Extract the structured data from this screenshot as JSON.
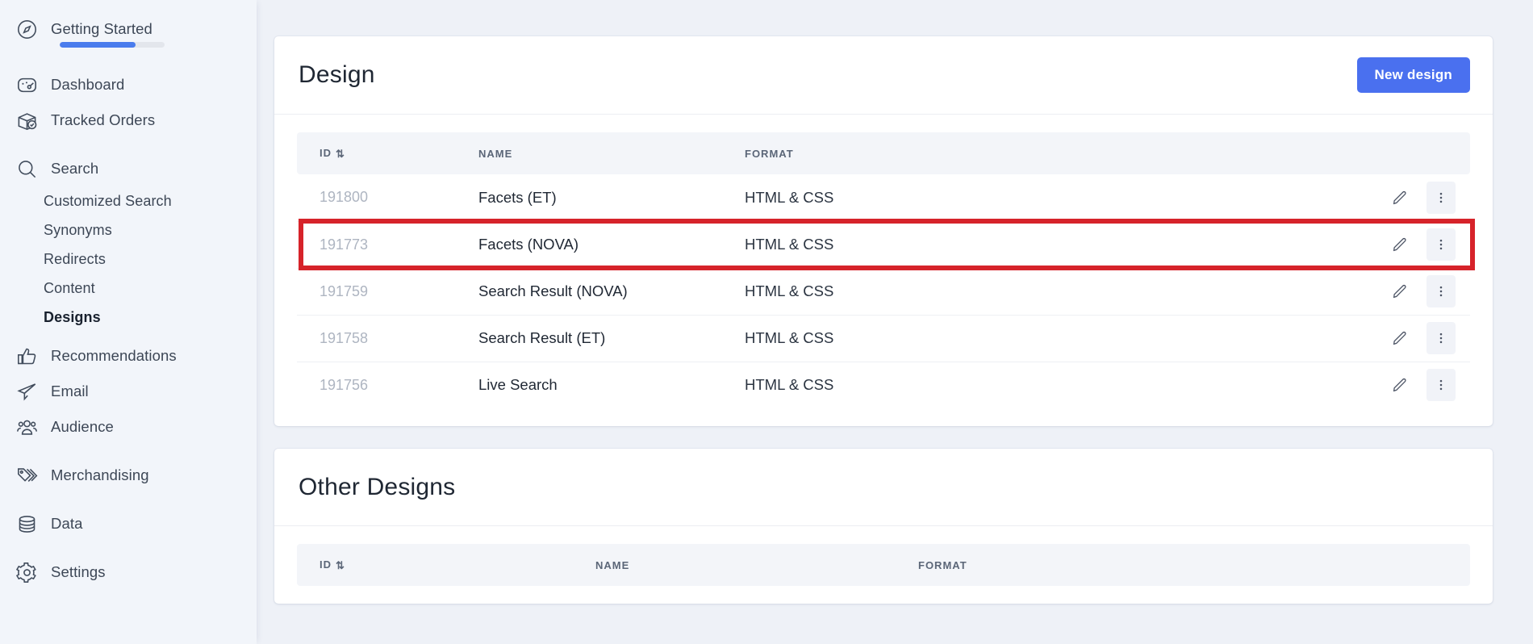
{
  "sidebar": {
    "getting_started": {
      "label": "Getting Started",
      "icon": "compass-icon",
      "progress_percent": 72
    },
    "items": [
      {
        "label": "Dashboard",
        "icon": "gauge-icon",
        "type": "top"
      },
      {
        "label": "Tracked Orders",
        "icon": "package-check-icon",
        "type": "top"
      },
      {
        "label": "Search",
        "icon": "search-icon",
        "type": "top"
      },
      {
        "label": "Customized Search",
        "icon": "",
        "type": "sub"
      },
      {
        "label": "Synonyms",
        "icon": "",
        "type": "sub"
      },
      {
        "label": "Redirects",
        "icon": "",
        "type": "sub"
      },
      {
        "label": "Content",
        "icon": "",
        "type": "sub"
      },
      {
        "label": "Designs",
        "icon": "",
        "type": "sub",
        "active": true
      },
      {
        "label": "Recommendations",
        "icon": "thumbs-up-icon",
        "type": "top"
      },
      {
        "label": "Email",
        "icon": "paper-plane-icon",
        "type": "top"
      },
      {
        "label": "Audience",
        "icon": "people-icon",
        "type": "top"
      },
      {
        "label": "Merchandising",
        "icon": "tags-icon",
        "type": "top"
      },
      {
        "label": "Data",
        "icon": "database-icon",
        "type": "top"
      },
      {
        "label": "Settings",
        "icon": "gear-icon",
        "type": "top"
      }
    ]
  },
  "design_card": {
    "title": "Design",
    "new_button_label": "New design",
    "columns": [
      "ID",
      "NAME",
      "FORMAT"
    ],
    "sort_glyph": "⇅",
    "rows": [
      {
        "id": "191800",
        "name": "Facets (ET)",
        "format": "HTML & CSS"
      },
      {
        "id": "191773",
        "name": "Facets (NOVA)",
        "format": "HTML & CSS"
      },
      {
        "id": "191759",
        "name": "Search Result (NOVA)",
        "format": "HTML & CSS"
      },
      {
        "id": "191758",
        "name": "Search Result (ET)",
        "format": "HTML & CSS"
      },
      {
        "id": "191756",
        "name": "Live Search",
        "format": "HTML & CSS"
      }
    ],
    "highlighted_row_index": 1
  },
  "other_designs_card": {
    "title": "Other Designs",
    "columns": [
      "ID",
      "NAME",
      "FORMAT"
    ],
    "sort_glyph": "⇅",
    "rows": []
  },
  "colors": {
    "accent": "#4a70ef",
    "progress": "#4a7ced",
    "highlight": "#d6232a",
    "sidebar_bg": "#f2f5fa",
    "page_bg": "#eef1f7",
    "card_bg": "#ffffff",
    "table_head_bg": "#f3f5f9"
  }
}
